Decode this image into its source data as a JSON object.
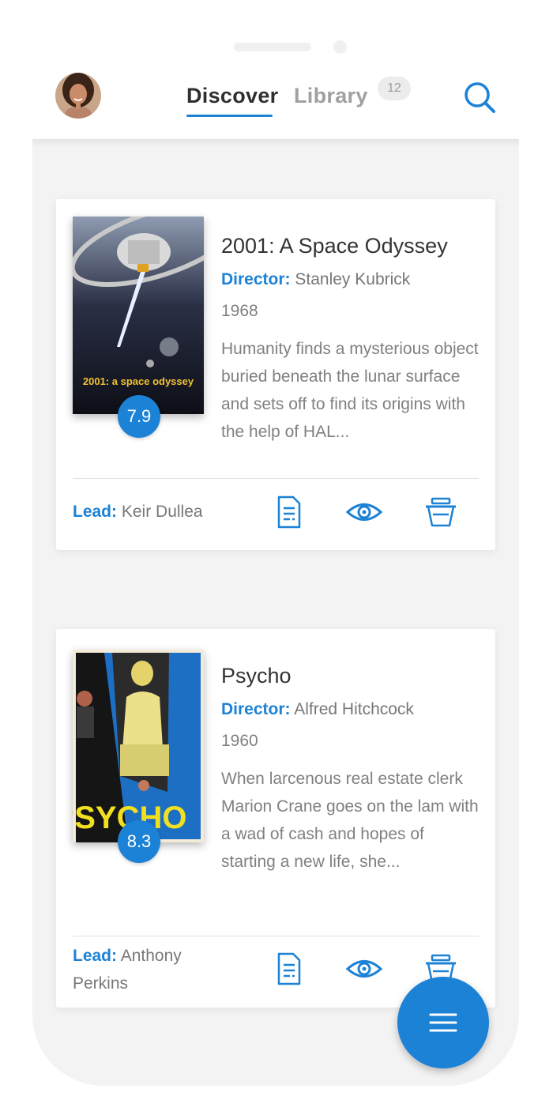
{
  "header": {
    "tabs": [
      {
        "label": "Discover",
        "active": true
      },
      {
        "label": "Library",
        "active": false
      }
    ],
    "library_count": "12",
    "accent_color": "#1c82d6",
    "search_icon": "search-icon",
    "avatar": "user-avatar"
  },
  "movies": [
    {
      "title": "2001: A Space Odyssey",
      "director_label": "Director:",
      "director": "Stanley Kubrick",
      "year": "1968",
      "description": "Humanity finds a mysterious object buried beneath the lunar surface and sets off to find its origins with the help of HAL...",
      "rating": "7.9",
      "lead_label": "Lead:",
      "lead": "Keir Dullea",
      "poster_text": "2001: a space odyssey",
      "actions": [
        "details-icon",
        "eye-icon",
        "bucket-icon"
      ]
    },
    {
      "title": "Psycho",
      "director_label": "Director:",
      "director": "Alfred Hitchcock",
      "year": "1960",
      "description": "When larcenous real estate clerk Marion Crane goes on the lam with a wad of cash and hopes of starting a new life, she...",
      "rating": "8.3",
      "lead_label": "Lead:",
      "lead": "Anthony Perkins",
      "poster_text": "PSYCHO",
      "actions": [
        "details-icon",
        "eye-icon",
        "bucket-icon"
      ]
    }
  ],
  "fab": {
    "icon": "menu-icon"
  }
}
